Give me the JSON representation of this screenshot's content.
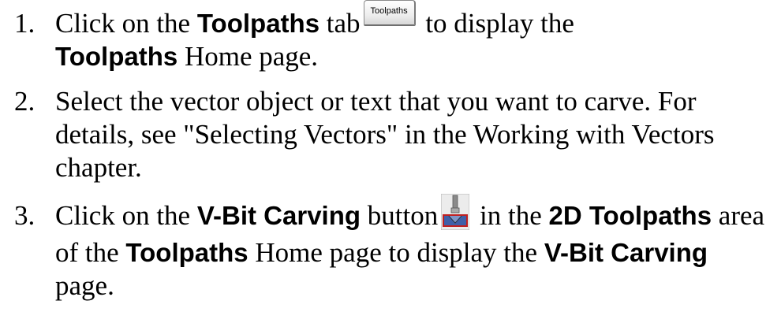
{
  "steps": [
    {
      "number": "1.",
      "parts": {
        "t1": "Click on the ",
        "b1": "Toolpaths",
        "t2": " tab",
        "button_label": "Toolpaths",
        "t3": " to display the",
        "b2": "Toolpaths",
        "t4": " Home page."
      }
    },
    {
      "number": "2.",
      "text": "Select the vector object or text that you want to carve. For details, see \"Selecting Vectors\" in the Working with Vectors chapter."
    },
    {
      "number": "3.",
      "parts": {
        "t1": "Click on the ",
        "b1": "V-Bit Carving",
        "t2": " button",
        "t3": " in the ",
        "b2": "2D Toolpaths",
        "t4": " area of the ",
        "b3": "Toolpaths",
        "t5": " Home page to display the ",
        "b4": "V-Bit Carving",
        "t6": " page."
      },
      "icon": "v-bit-carving-icon"
    }
  ]
}
